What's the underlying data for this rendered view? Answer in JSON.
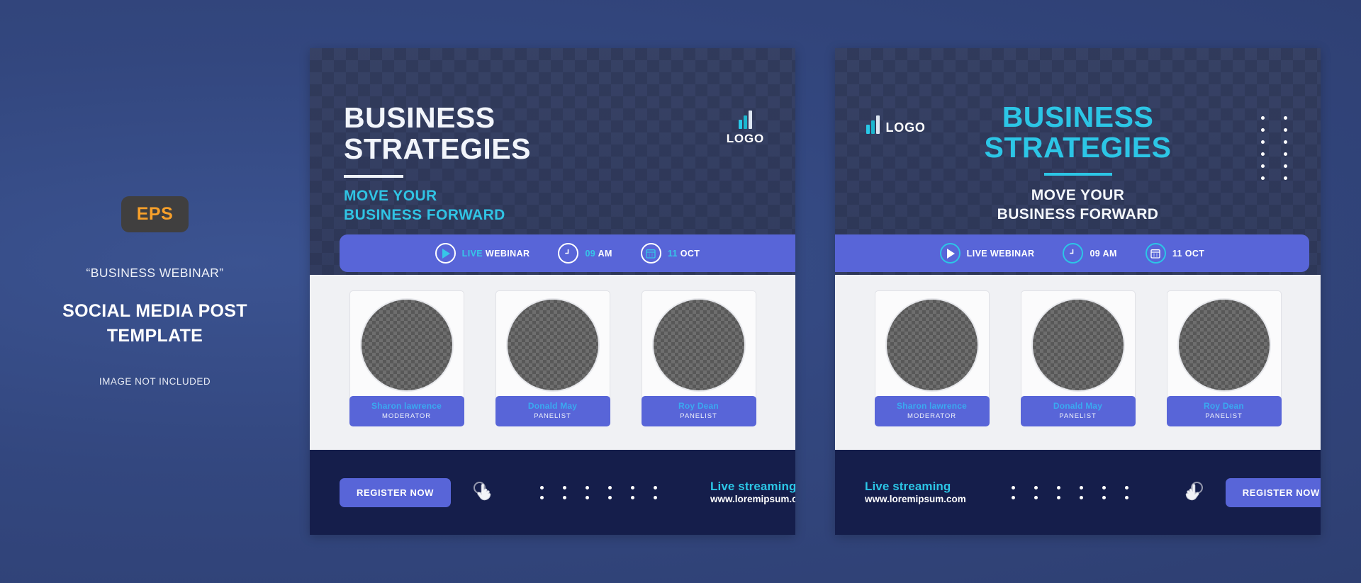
{
  "info_panel": {
    "badge": "EPS",
    "quote": "“BUSINESS WEBINAR”",
    "title_line1": "SOCIAL MEDIA POST",
    "title_line2": "TEMPLATE",
    "note": "IMAGE NOT INCLUDED"
  },
  "colors": {
    "background": "#33477f",
    "poster_body": "#1b2350",
    "header_checker": "#3a4569",
    "accent_cyan": "#2cc6e6",
    "accent_indigo": "#5865d8",
    "footer_navy": "#151e4b",
    "speakers_bg": "#f0f1f4",
    "name_blue": "#3aa9f0",
    "eps_orange": "#f7a02a",
    "eps_badge_bg": "#403f3f"
  },
  "posters": [
    {
      "id": "poster-left",
      "logo_text": "LOGO",
      "logo_icon": "bar-chart-logo-icon",
      "title_line1": "BUSINESS",
      "title_line2": "STRATEGIES",
      "subtitle_line1": "MOVE YOUR",
      "subtitle_line2": "BUSINESS FORWARD",
      "info_items": [
        {
          "icon": "play-icon",
          "label_accent": "LIVE",
          "label_main": "WEBINAR"
        },
        {
          "icon": "clock-icon",
          "label_accent": "09",
          "label_main": "AM"
        },
        {
          "icon": "calendar-icon",
          "label_accent": "11",
          "label_main": "OCT"
        }
      ],
      "speakers": [
        {
          "name": "Sharon lawrence",
          "role": "MODERATOR"
        },
        {
          "name": "Donald May",
          "role": "PANELIST"
        },
        {
          "name": "Roy Dean",
          "role": "PANELIST"
        }
      ],
      "cta_label": "REGISTER NOW",
      "stream_title": "Live streaming",
      "stream_url": "www.loremipsum.com",
      "footer_dots": 12
    },
    {
      "id": "poster-right",
      "logo_text": "LOGO",
      "logo_icon": "bar-chart-logo-icon",
      "title_line1": "BUSINESS",
      "title_line2": "STRATEGIES",
      "subtitle_line1": "MOVE YOUR",
      "subtitle_line2": "BUSINESS FORWARD",
      "header_dots": 12,
      "info_items": [
        {
          "icon": "play-icon",
          "label_accent": "LIVE",
          "label_main": "WEBINAR"
        },
        {
          "icon": "clock-icon",
          "label_accent": "09",
          "label_main": "AM"
        },
        {
          "icon": "calendar-icon",
          "label_accent": "11",
          "label_main": "OCT"
        }
      ],
      "speakers": [
        {
          "name": "Sharon lawrence",
          "role": "MODERATOR"
        },
        {
          "name": "Donald May",
          "role": "PANELIST"
        },
        {
          "name": "Roy Dean",
          "role": "PANELIST"
        }
      ],
      "cta_label": "REGISTER NOW",
      "stream_title": "Live streaming",
      "stream_url": "www.loremipsum.com",
      "footer_dots": 12
    }
  ]
}
